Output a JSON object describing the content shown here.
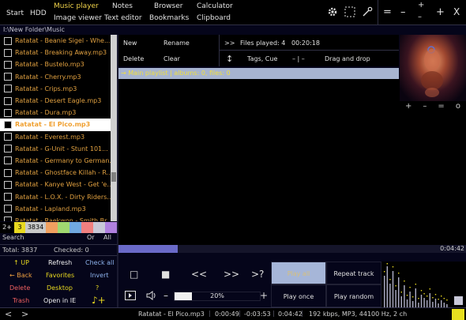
{
  "top": {
    "start": "Start",
    "hdd": "HDD",
    "music_player": "Music player",
    "image_viewer": "Image viewer",
    "notes": "Notes",
    "text_editor": "Text editor",
    "browser": "Browser",
    "bookmarks": "Bookmarks",
    "calculator": "Calculator",
    "clipboard": "Clipboard",
    "win_eq": "=",
    "win_minus": "–",
    "win_plus": "+",
    "win_plus2": "+",
    "win_minus2": "–",
    "win_close": "X"
  },
  "path": "I:\\New Folder\\Music",
  "files": [
    {
      "name": "Ratatat - Beanie Sigel - Whe...",
      "selected": false
    },
    {
      "name": "Ratatat - Breaking Away.mp3",
      "selected": false
    },
    {
      "name": "Ratatat - Bustelo.mp3",
      "selected": false
    },
    {
      "name": "Ratatat - Cherry.mp3",
      "selected": false
    },
    {
      "name": "Ratatat - Crips.mp3",
      "selected": false
    },
    {
      "name": "Ratatat - Desert Eagle.mp3",
      "selected": false
    },
    {
      "name": "Ratatat - Dura.mp3",
      "selected": false
    },
    {
      "name": "Ratatat - El Pico.mp3",
      "selected": true
    },
    {
      "name": "Ratatat - Everest.mp3",
      "selected": false
    },
    {
      "name": "Ratatat - G-Unit - Stunt 101...",
      "selected": false
    },
    {
      "name": "Ratatat - Germany to German...",
      "selected": false
    },
    {
      "name": "Ratatat - Ghostface Killah - R...",
      "selected": false
    },
    {
      "name": "Ratatat - Kanye West - Get 'e...",
      "selected": false
    },
    {
      "name": "Ratatat - L.O.X. - Dirty Riders...",
      "selected": false
    },
    {
      "name": "Ratatat - Lapland.mp3",
      "selected": false
    },
    {
      "name": "Ratatat - Raekwon - Smith Br...",
      "selected": false
    }
  ],
  "letters": [
    {
      "label": "2+",
      "color": "#000000",
      "text_color": "#e0e0e0"
    },
    {
      "label": "3",
      "color": "#e8d820",
      "text_color": "#000000"
    },
    {
      "label": "3834",
      "color": "#c8c8c8",
      "text_color": "#000000"
    },
    {
      "label": "",
      "color": "#f0a060",
      "text_color": "#000000"
    },
    {
      "label": "",
      "color": "#a0d870",
      "text_color": "#000000"
    },
    {
      "label": "",
      "color": "#70a8e0",
      "text_color": "#000000"
    },
    {
      "label": "",
      "color": "#f08080",
      "text_color": "#000000"
    },
    {
      "label": "",
      "color": "#c8c8d8",
      "text_color": "#000000"
    },
    {
      "label": "",
      "color": "#b080e0",
      "text_color": "#000000"
    }
  ],
  "search": {
    "label": "Search",
    "or": "Or",
    "all": "All"
  },
  "totals": {
    "total": "Total: 3837",
    "checked": "Checked: 0"
  },
  "commands": {
    "up": "↑ UP",
    "refresh": "Refresh",
    "check_all": "Check all",
    "back": "← Back",
    "favorites": "Favorites",
    "invert": "Invert",
    "delete": "Delete",
    "desktop": "Desktop",
    "help": "?",
    "trash": "Trash",
    "open_in_ie": "Open in IE",
    "note_plus": "♪+"
  },
  "toolbar": {
    "new": "New",
    "rename": "Rename",
    "delete": "Delete",
    "clear": "Clear",
    "skip": ">>",
    "files_played": "Files played: 4",
    "time_played": "00:20:18",
    "sort_icon": "↕",
    "tags_cue": "Tags, Cue",
    "separator": "– | –",
    "drag_drop": "Drag and drop"
  },
  "playlist_header": "→  Main playlist   |   albums: 0,  files: 0",
  "art_controls": [
    "+",
    "–",
    "=",
    "o"
  ],
  "progress": {
    "time": "0:04:42",
    "fraction": 0.17
  },
  "player": {
    "stop": "□",
    "pause": "■",
    "prev": "<<",
    "next": ">>",
    "random_next": ">?",
    "volume": "20%",
    "volume_fraction": 0.2,
    "vol_minus": "–",
    "vol_plus": "+"
  },
  "modes": {
    "play_all": "Play all",
    "repeat_track": "Repeat track",
    "play_once": "Play once",
    "play_random": "Play random"
  },
  "status": {
    "prev": "<",
    "next": ">",
    "track": "Ratatat - El Pico.mp3",
    "elapsed": "0:00:49",
    "remaining": "-0:03:53",
    "duration": "0:04:42",
    "info": "192 kbps, MP3, 44100 Hz, 2 ch"
  },
  "colors": {
    "accent": "#e8d820",
    "file_text": "#e0a040",
    "playlist_header": "#a7b4d0"
  }
}
